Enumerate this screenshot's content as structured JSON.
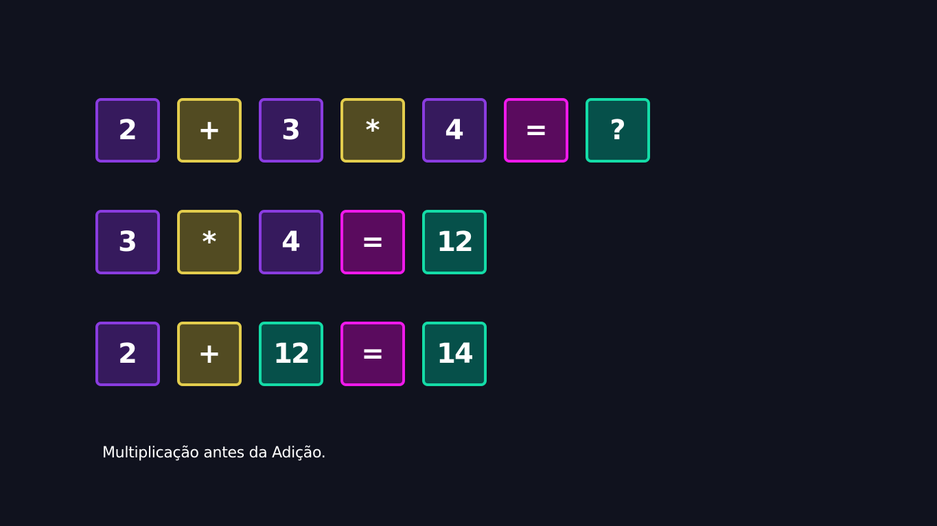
{
  "colors": {
    "background": "#10121e",
    "number_fill": "#361a5d",
    "number_border": "#8a3ce0",
    "operator_fill": "#524b22",
    "operator_border": "#e3cd4d",
    "equals_fill": "#5a0b5e",
    "equals_border": "#f019eb",
    "result_fill": "#06504a",
    "result_border": "#14dca7"
  },
  "rows": [
    {
      "tiles": [
        {
          "text": "2",
          "kind": "number"
        },
        {
          "text": "+",
          "kind": "operator"
        },
        {
          "text": "3",
          "kind": "number"
        },
        {
          "text": "*",
          "kind": "operator"
        },
        {
          "text": "4",
          "kind": "number"
        },
        {
          "text": "=",
          "kind": "equals"
        },
        {
          "text": "?",
          "kind": "result"
        }
      ]
    },
    {
      "tiles": [
        {
          "text": "3",
          "kind": "number"
        },
        {
          "text": "*",
          "kind": "operator"
        },
        {
          "text": "4",
          "kind": "number"
        },
        {
          "text": "=",
          "kind": "equals"
        },
        {
          "text": "12",
          "kind": "result"
        }
      ]
    },
    {
      "tiles": [
        {
          "text": "2",
          "kind": "number"
        },
        {
          "text": "+",
          "kind": "operator"
        },
        {
          "text": "12",
          "kind": "result"
        },
        {
          "text": "=",
          "kind": "equals"
        },
        {
          "text": "14",
          "kind": "result"
        }
      ]
    }
  ],
  "caption": "Multiplicação antes da Adição."
}
